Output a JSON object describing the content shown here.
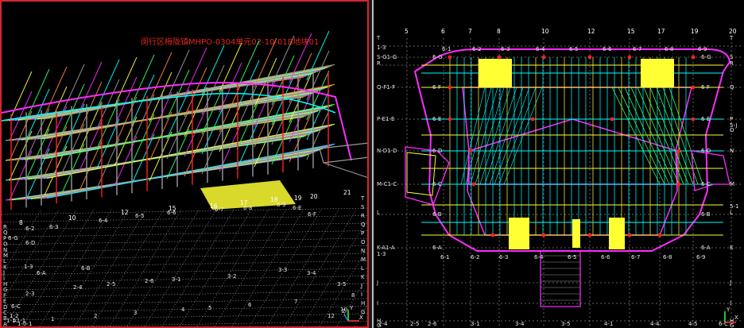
{
  "left_view": {
    "title": "闵行区梅陇镇MHPO-0304单元02-10-01B地块01",
    "grid_top_labels": [
      "8",
      "10",
      "12",
      "15",
      "16",
      "17",
      "18",
      "19",
      "20",
      "21"
    ],
    "grid_row_labels": [
      "6-2",
      "6-3",
      "6-4",
      "6-5",
      "6-6",
      "6-7",
      "6-8",
      "6-9",
      "6-E",
      "6-D",
      "6-F",
      "6-G"
    ],
    "grid_left_labels": [
      "R",
      "Q",
      "P",
      "O",
      "N",
      "M",
      "L",
      "K",
      "J",
      "I",
      "H",
      "G",
      "F",
      "E",
      "D",
      "C",
      "B",
      "A"
    ],
    "grid_bottom_labels": [
      "1-3",
      "2-3",
      "2-4",
      "2-5",
      "2-6",
      "3-1",
      "3-2",
      "3-3",
      "3-4",
      "3-5",
      "6-A",
      "6-B",
      "6-C",
      "1-2",
      "1-1",
      "1-0-1",
      "A1-1",
      "1",
      "2",
      "3",
      "4",
      "5",
      "6",
      "7",
      "8",
      "10",
      "12"
    ],
    "right_side_labels": [
      "T",
      "S",
      "R",
      "Q",
      "P",
      "O",
      "N",
      "M",
      "L",
      "K",
      "J",
      "I",
      "H",
      "G"
    ],
    "gizmo": {
      "x": "X",
      "y": "Y",
      "z": "Z"
    }
  },
  "right_view": {
    "top_columns": [
      "5",
      "6",
      "7",
      "8",
      "10",
      "12",
      "15",
      "17",
      "19",
      "20"
    ],
    "sub_columns": [
      "6-1",
      "6-2",
      "6-3",
      "6-4",
      "6-5",
      "6-6",
      "6-7",
      "6-8",
      "6-9"
    ],
    "bottom_sub_columns": [
      "6-1",
      "6-2",
      "6-3",
      "6-4",
      "6-5",
      "6-6",
      "6-7",
      "6-8",
      "6-9"
    ],
    "left_rows": [
      "T",
      "1-3",
      "S-G1-G",
      "R",
      "Q-F1-F",
      "P-E1-E",
      "N-D1-D",
      "M-C1-C",
      "L",
      "K-A1-A",
      "1-3",
      "J",
      "I",
      "H",
      "G"
    ],
    "right_rows": [
      "T",
      "S",
      "R",
      "Q",
      "P",
      "5-J",
      "O",
      "N",
      "M",
      "5-1",
      "L",
      "K",
      "J",
      "I",
      "H",
      "G"
    ],
    "inner_rows_left": [
      "6-G",
      "6-F",
      "6-E",
      "6-D",
      "6-C",
      "6-B",
      "6-A"
    ],
    "inner_rows_right": [
      "6-G",
      "6-F",
      "6-E",
      "6-D",
      "6-C",
      "6-B",
      "6-A"
    ],
    "bottom_labels": [
      "2-4",
      "2-5",
      "2-6",
      "3-1",
      "3-4",
      "3-5",
      "4-1",
      "4-4",
      "4-5",
      "6-C"
    ],
    "gizmo": {
      "x": "X",
      "y": "Y"
    }
  },
  "colors": {
    "magenta": "#ff2bff",
    "yellow": "#ffff33",
    "cyan": "#00ffff",
    "green": "#33ff66",
    "grey": "#9a9a9a",
    "red": "#ff2020",
    "white": "#ffffff",
    "active_border": "#d6262f"
  }
}
